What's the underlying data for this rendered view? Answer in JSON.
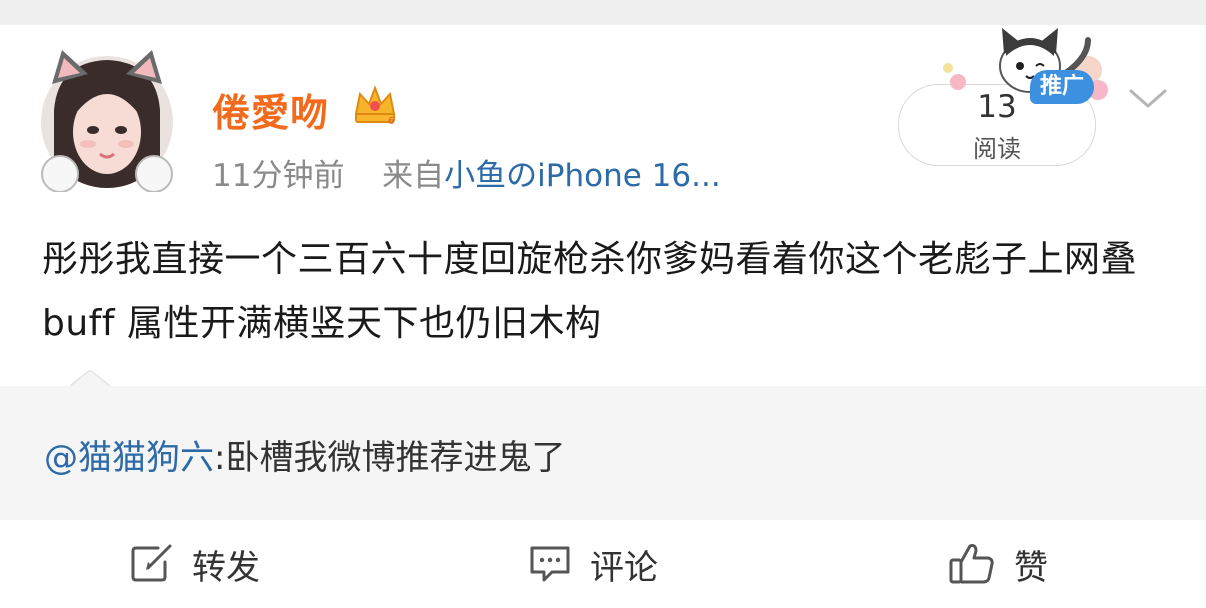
{
  "post": {
    "username": "倦愛吻",
    "time": "11分钟前",
    "source_prefix": "来自",
    "source": "小鱼のiPhone 16...",
    "read_count": "13",
    "read_label": "阅读",
    "promo_tag": "推广",
    "text": "彤彤我直接一个三百六十度回旋枪杀你爹妈看着你这个老彪子上网叠buff 属性开满横竖天下也仍旧木构"
  },
  "quote": {
    "user": "@猫猫狗六",
    "sep": ":",
    "text": "卧槽我微博推荐进鬼了"
  },
  "actions": {
    "repost_label": "转发",
    "comment_label": "评论",
    "like_label": "赞"
  },
  "colors": {
    "username": "#f26a1b",
    "link": "#2d6aa8",
    "promo_tag": "#3d8fe0"
  },
  "icons": [
    "avatar",
    "vip-crown-icon",
    "cat-mascot",
    "chevron-down-icon",
    "repost-icon",
    "comment-icon",
    "like-icon"
  ]
}
